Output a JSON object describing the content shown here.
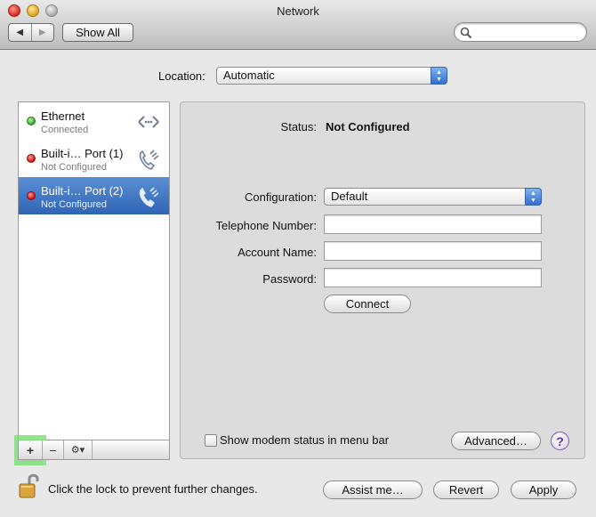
{
  "window": {
    "title": "Network"
  },
  "toolbar": {
    "back_glyph": "◀",
    "forward_glyph": "▶",
    "show_all_label": "Show All",
    "search_placeholder": ""
  },
  "location": {
    "label": "Location:",
    "value": "Automatic"
  },
  "services": [
    {
      "name": "Ethernet",
      "status": "Connected",
      "status_color": "#2ea82a",
      "icon": "ethernet-icon"
    },
    {
      "name": "Built-i… Port (1)",
      "status": "Not Configured",
      "status_color": "#cc1010",
      "icon": "phone-icon"
    },
    {
      "name": "Built-i… Port (2)",
      "status": "Not Configured",
      "status_color": "#cc1010",
      "icon": "phone-icon",
      "selected": true
    }
  ],
  "list_buttons": {
    "add": "+",
    "remove": "−",
    "action": "⚙▾"
  },
  "detail": {
    "status_label": "Status:",
    "status_value": "Not Configured",
    "configuration_label": "Configuration:",
    "configuration_value": "Default",
    "telephone_label": "Telephone Number:",
    "telephone_value": "",
    "account_label": "Account Name:",
    "account_value": "",
    "password_label": "Password:",
    "password_value": "",
    "connect_label": "Connect",
    "show_modem_label": "Show modem status in menu bar",
    "show_modem_checked": false,
    "advanced_label": "Advanced…",
    "help_glyph": "?"
  },
  "footer": {
    "lock_text": "Click the lock to prevent further changes.",
    "assist_label": "Assist me…",
    "revert_label": "Revert",
    "apply_label": "Apply"
  },
  "colors": {
    "selection": "#2f64b6",
    "add_highlight": "#7de07a"
  }
}
